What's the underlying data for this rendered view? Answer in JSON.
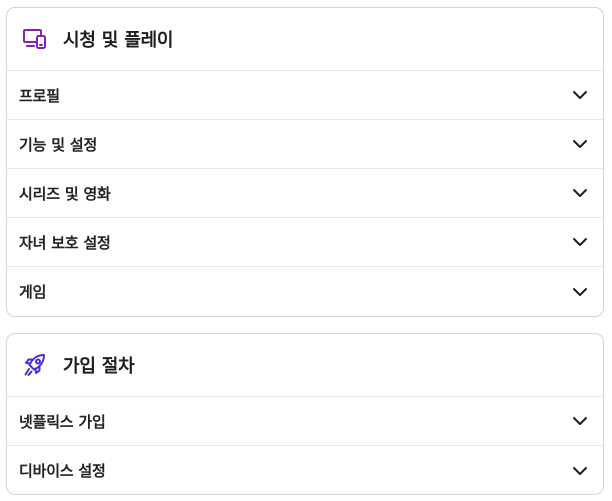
{
  "sections": [
    {
      "title": "시청 및 플레이",
      "icon": "devices-icon",
      "items": [
        {
          "label": "프로필"
        },
        {
          "label": "기능 및 설정"
        },
        {
          "label": "시리즈 및 영화"
        },
        {
          "label": "자녀 보호 설정"
        },
        {
          "label": "게임"
        }
      ]
    },
    {
      "title": "가입 절차",
      "icon": "rocket-icon",
      "items": [
        {
          "label": "넷플릭스 가입"
        },
        {
          "label": "디바이스 설정"
        }
      ]
    }
  ],
  "colors": {
    "accent_icon_devices": "#8a1fb5",
    "accent_icon_rocket": "#4b2bd6",
    "text": "#1f1f1f",
    "border": "#d4d4d4",
    "divider": "#e6e6e6"
  }
}
